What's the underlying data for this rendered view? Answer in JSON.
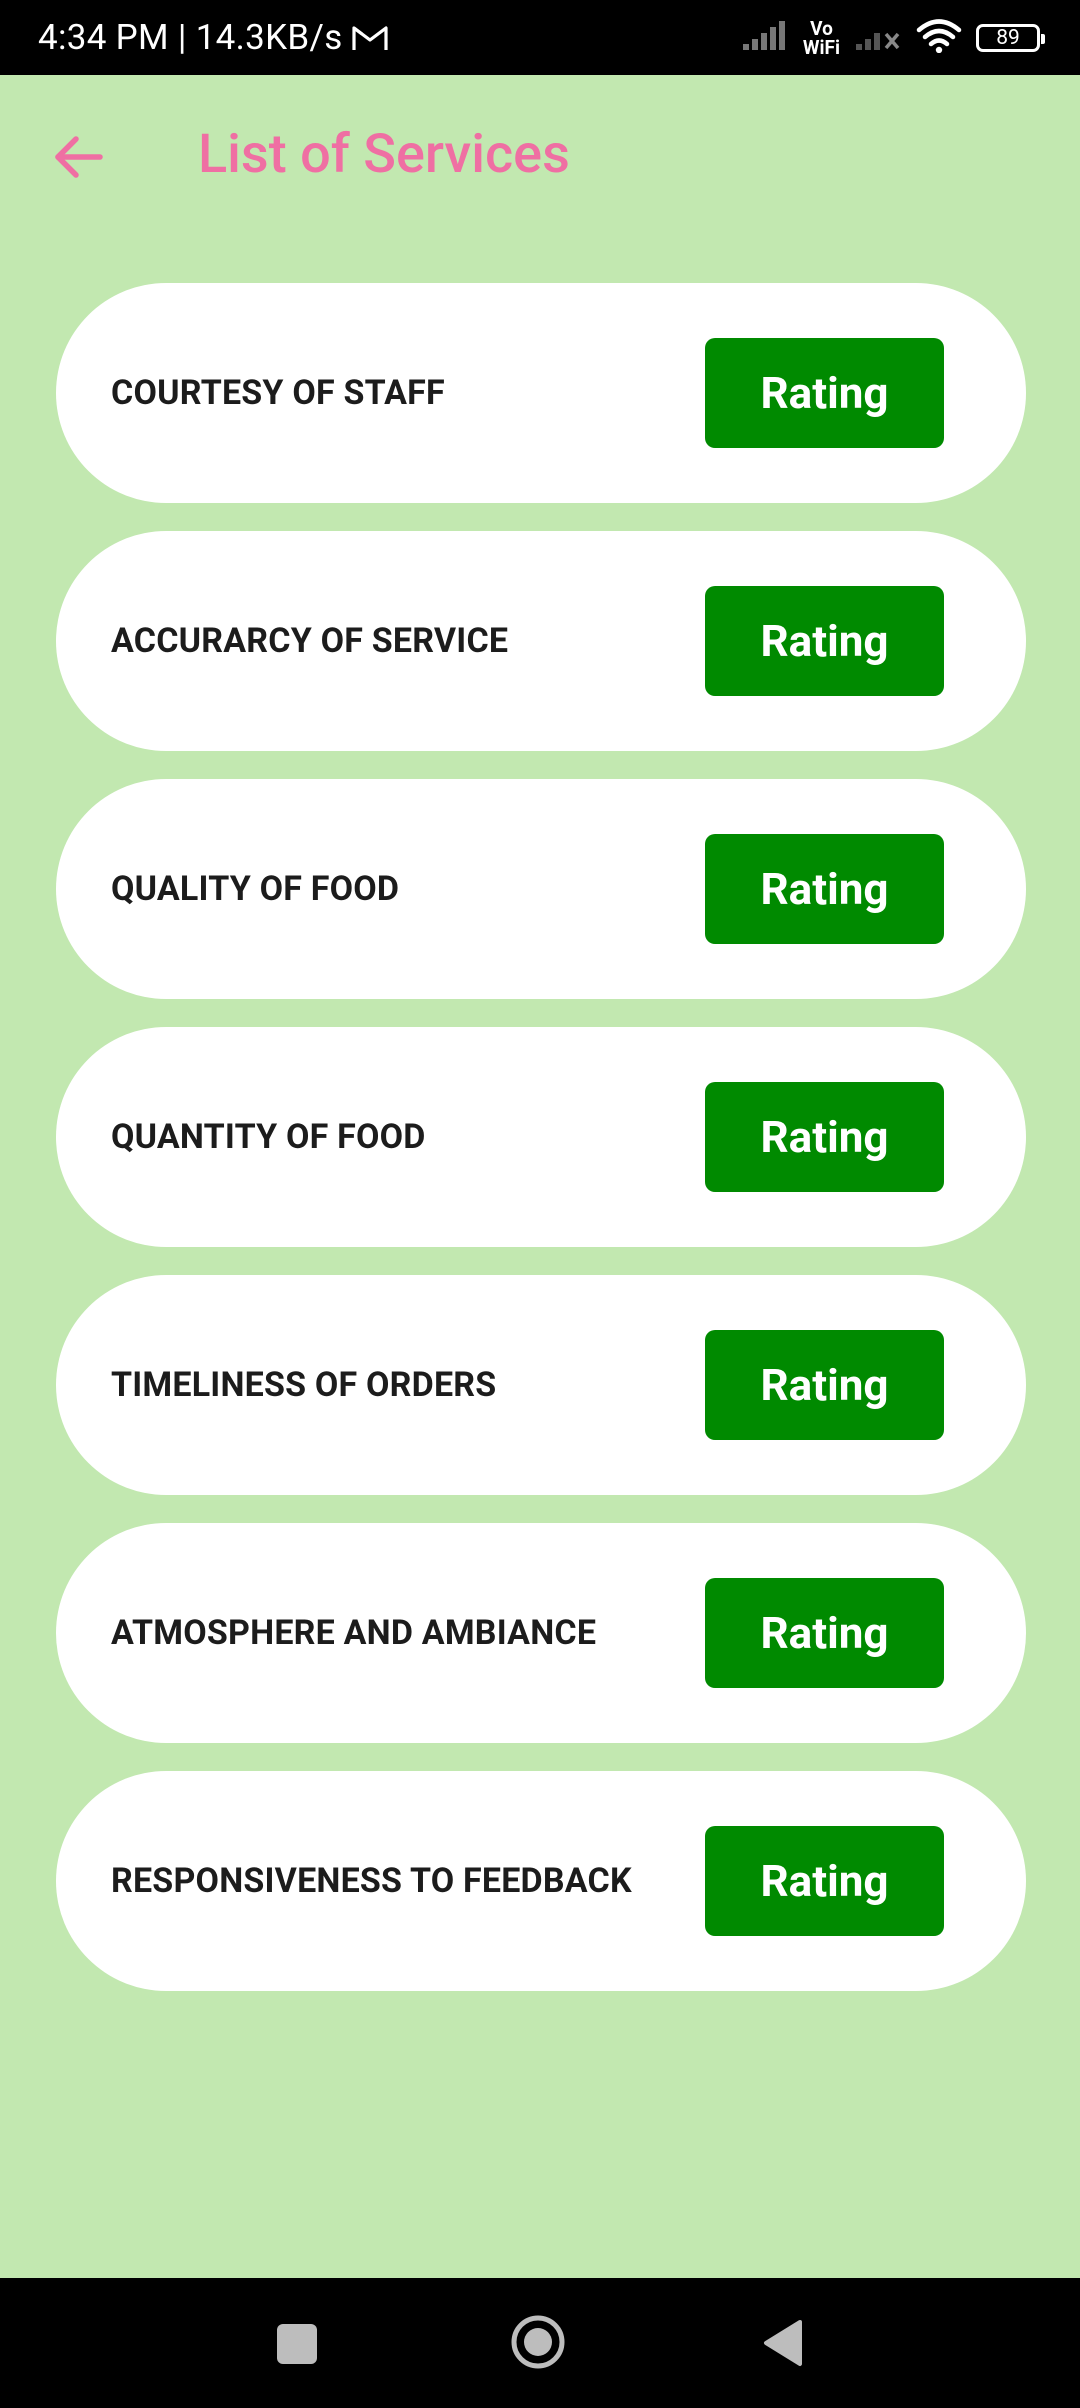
{
  "status_bar": {
    "time_speed": "4:34 PM | 14.3KB/s",
    "vowifi_top": "Vo",
    "vowifi_bottom": "WiFi",
    "battery": "89"
  },
  "header": {
    "title": "List of Services"
  },
  "services": [
    {
      "label": "COURTESY OF STAFF",
      "button": "Rating"
    },
    {
      "label": "ACCURARCY OF SERVICE",
      "button": "Rating"
    },
    {
      "label": "QUALITY OF FOOD",
      "button": "Rating"
    },
    {
      "label": "QUANTITY OF FOOD",
      "button": "Rating"
    },
    {
      "label": "TIMELINESS OF ORDERS",
      "button": "Rating"
    },
    {
      "label": "ATMOSPHERE AND AMBIANCE",
      "button": "Rating"
    },
    {
      "label": "RESPONSIVENESS TO FEEDBACK",
      "button": "Rating"
    }
  ],
  "colors": {
    "background": "#c2e8b0",
    "accent_pink": "#ef6fa3",
    "button_green": "#008a00"
  },
  "icons": {
    "back": "arrow-left-icon",
    "mail": "gmail-icon",
    "nav_recent": "square-icon",
    "nav_home": "circle-icon",
    "nav_back": "triangle-icon"
  }
}
